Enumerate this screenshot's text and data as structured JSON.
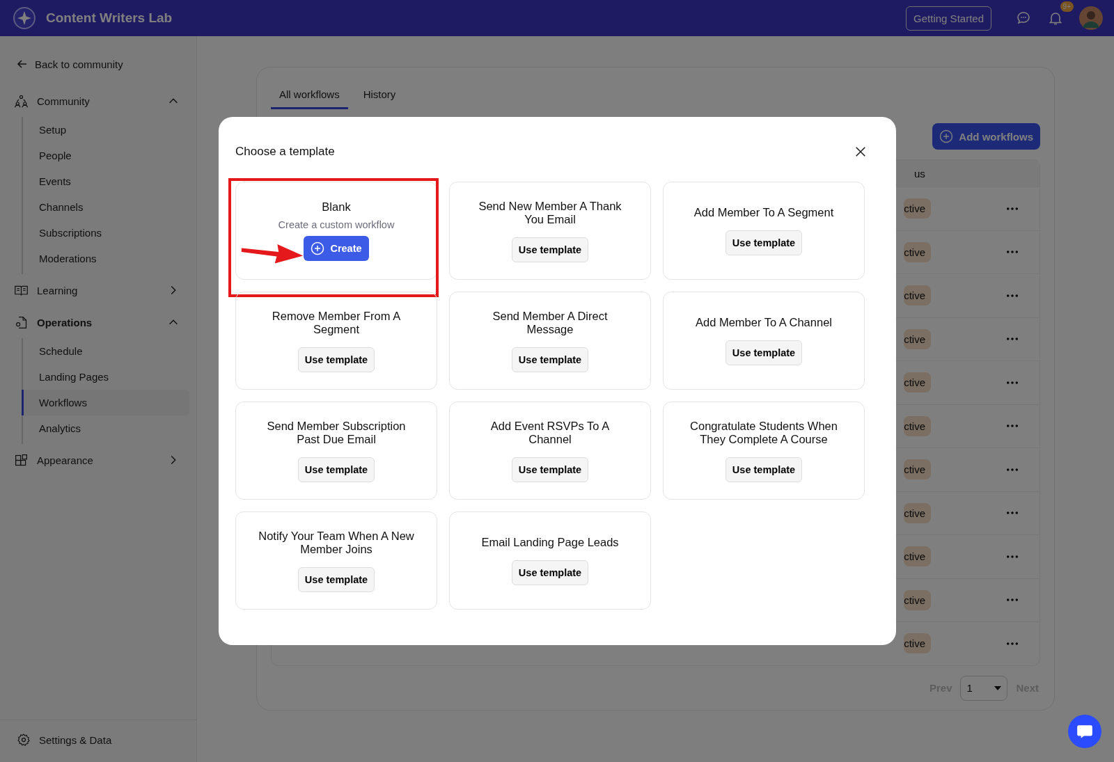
{
  "app": {
    "name": "Content Writers Lab"
  },
  "top_bar": {
    "getting_started": "Getting Started",
    "notification_count": "9+"
  },
  "sidebar": {
    "back": "Back to community",
    "sections": [
      {
        "label": "Community",
        "expanded": true,
        "active": false,
        "children": [
          {
            "label": "Setup",
            "selected": false
          },
          {
            "label": "People",
            "selected": false
          },
          {
            "label": "Events",
            "selected": false
          },
          {
            "label": "Channels",
            "selected": false
          },
          {
            "label": "Subscriptions",
            "selected": false
          },
          {
            "label": "Moderations",
            "selected": false
          }
        ]
      },
      {
        "label": "Learning",
        "expanded": false,
        "active": false
      },
      {
        "label": "Operations",
        "expanded": true,
        "active": true,
        "children": [
          {
            "label": "Schedule",
            "selected": false
          },
          {
            "label": "Landing Pages",
            "selected": false
          },
          {
            "label": "Workflows",
            "selected": true
          },
          {
            "label": "Analytics",
            "selected": false
          }
        ]
      },
      {
        "label": "Appearance",
        "expanded": false,
        "active": false
      }
    ],
    "footer": "Settings & Data"
  },
  "tabs": [
    {
      "label": "All workflows",
      "selected": true
    },
    {
      "label": "History",
      "selected": false
    }
  ],
  "add_button": "Add workflows",
  "table": {
    "columns": [
      "us"
    ],
    "rows": [
      {
        "status": "ctive"
      },
      {
        "status": "ctive"
      },
      {
        "status": "ctive"
      },
      {
        "status": "ctive"
      },
      {
        "status": "ctive"
      },
      {
        "status": "ctive"
      },
      {
        "status": "ctive"
      },
      {
        "status": "ctive"
      },
      {
        "status": "ctive"
      },
      {
        "status": "ctive"
      },
      {
        "status": "ctive"
      }
    ]
  },
  "pagination": {
    "prev": "Prev",
    "page": "1",
    "next": "Next"
  },
  "modal": {
    "title": "Choose a template",
    "cards": [
      {
        "kind": "blank",
        "title": "Blank",
        "description": "Create a custom workflow",
        "button": "Create",
        "highlighted": true
      },
      {
        "kind": "template",
        "title": "Send New Member A Thank You Email",
        "button": "Use template",
        "highlighted": false
      },
      {
        "kind": "template",
        "title": "Add Member To A Segment",
        "button": "Use template",
        "highlighted": false
      },
      {
        "kind": "template",
        "title": "Remove Member From A Segment",
        "button": "Use template",
        "highlighted": false
      },
      {
        "kind": "template",
        "title": "Send Member A Direct Message",
        "button": "Use template",
        "highlighted": false
      },
      {
        "kind": "template",
        "title": "Add Member To A Channel",
        "button": "Use template",
        "highlighted": false
      },
      {
        "kind": "template",
        "title": "Send Member Subscription Past Due Email",
        "button": "Use template",
        "highlighted": false
      },
      {
        "kind": "template",
        "title": "Add Event RSVPs To A Channel",
        "button": "Use template",
        "highlighted": false
      },
      {
        "kind": "template",
        "title": "Congratulate Students When They Complete A Course",
        "button": "Use template",
        "highlighted": false
      },
      {
        "kind": "template",
        "title": "Notify Your Team When A New Member Joins",
        "button": "Use template",
        "highlighted": false
      },
      {
        "kind": "template",
        "title": "Email Landing Page Leads",
        "button": "Use template",
        "highlighted": false
      }
    ]
  }
}
